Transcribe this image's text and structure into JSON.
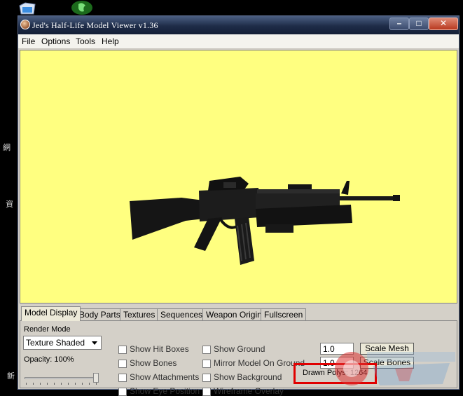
{
  "window": {
    "title": "Jed's Half-Life Model Viewer v1.36"
  },
  "menu": [
    "File",
    "Options",
    "Tools",
    "Help"
  ],
  "tabs": [
    "Model Display",
    "Body Parts",
    "Textures",
    "Sequences",
    "Weapon Origin",
    "Fullscreen"
  ],
  "model_display": {
    "render_mode_label": "Render Mode",
    "render_mode_value": "Texture Shaded",
    "opacity_label": "Opacity: 100%",
    "opacity_value": 1.0,
    "checkboxes_col1": [
      "Show Hit Boxes",
      "Show Bones",
      "Show Attachments",
      "Show Eye Position"
    ],
    "checkboxes_col2": [
      "Show Ground",
      "Mirror Model On Ground",
      "Show Background",
      "Wireframe Overlay"
    ],
    "scale_mesh_value": "1.0",
    "scale_mesh_label": "Scale Mesh",
    "scale_bones_value": "1.0",
    "scale_bones_label": "Scale Bones",
    "drawn_polys": "Drawn Polys: 1264"
  },
  "desktop_labels": [
    "網",
    "資",
    "新"
  ],
  "colors": {
    "viewport_bg": "#ffff80",
    "highlight": "#e00000"
  }
}
